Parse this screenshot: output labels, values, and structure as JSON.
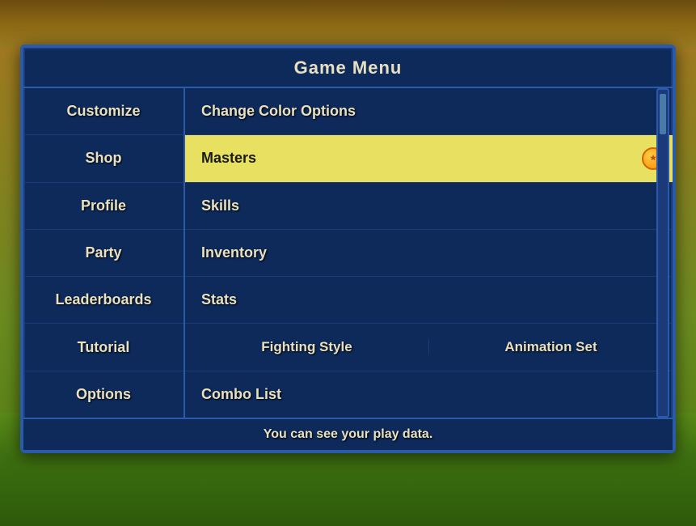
{
  "background": {
    "top_color": "#6B4C10",
    "grass_color": "#3d6e10"
  },
  "menu": {
    "title": "Game Menu",
    "nav_items": [
      {
        "id": "customize",
        "label": "Customize"
      },
      {
        "id": "shop",
        "label": "Shop"
      },
      {
        "id": "profile",
        "label": "Profile"
      },
      {
        "id": "party",
        "label": "Party"
      },
      {
        "id": "leaderboards",
        "label": "Leaderboards"
      },
      {
        "id": "tutorial",
        "label": "Tutorial"
      },
      {
        "id": "options",
        "label": "Options"
      }
    ],
    "content_items": [
      {
        "id": "change-color-options",
        "label": "Change Color Options",
        "type": "normal",
        "highlighted": false
      },
      {
        "id": "masters",
        "label": "Masters",
        "type": "normal",
        "highlighted": true
      },
      {
        "id": "skills",
        "label": "Skills",
        "type": "normal",
        "highlighted": false
      },
      {
        "id": "inventory",
        "label": "Inventory",
        "type": "normal",
        "highlighted": false
      },
      {
        "id": "stats",
        "label": "Stats",
        "type": "normal",
        "highlighted": false
      },
      {
        "id": "fighting-animation",
        "label": "",
        "type": "split",
        "highlighted": false,
        "split_items": [
          {
            "id": "fighting-style",
            "label": "Fighting Style"
          },
          {
            "id": "animation-set",
            "label": "Animation Set"
          }
        ]
      },
      {
        "id": "combo-list",
        "label": "Combo List",
        "type": "normal",
        "highlighted": false
      }
    ],
    "status_text": "You can see your play data."
  }
}
